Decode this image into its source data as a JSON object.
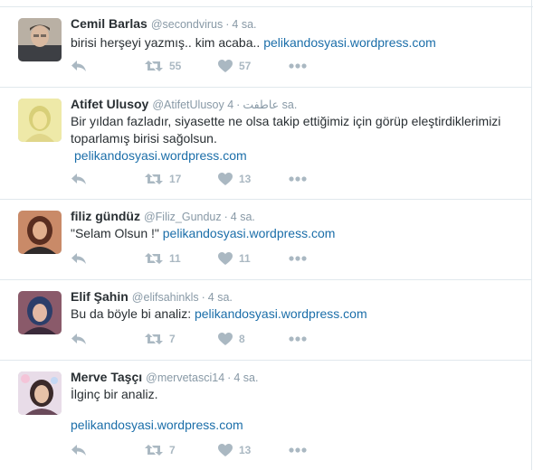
{
  "colors": {
    "link": "#1b6ea9",
    "meta": "#8899a6",
    "action": "#aab8c2",
    "separator": "#e1e8ed"
  },
  "tweets": [
    {
      "fullname": "Cemil Barlas",
      "username": "@secondvirus",
      "time": "4 sa.",
      "text": "birisi herşeyi yazmış.. kim acaba..",
      "link": "pelikandosyasi.wordpress.com",
      "retweets": "55",
      "likes": "57"
    },
    {
      "fullname": "Atifet Ulusoy",
      "username": "@AtifetUlusoy عاطفت",
      "time": "4 sa.",
      "text": "Bir yıldan fazladır, siyasette ne olsa takip ettiğimiz için görüp eleştirdiklerimizi toparlamış birisi sağolsun.",
      "link": "pelikandosyasi.wordpress.com",
      "retweets": "17",
      "likes": "13"
    },
    {
      "fullname": "filiz gündüz",
      "username": "@Filiz_Gunduz",
      "time": "4 sa.",
      "text": "\"Selam Olsun !\"",
      "link": "pelikandosyasi.wordpress.com",
      "retweets": "11",
      "likes": "11"
    },
    {
      "fullname": "Elif Şahin",
      "username": "@elifsahinkls",
      "time": "4 sa.",
      "text": "Bu da böyle bi analiz:",
      "link": "pelikandosyasi.wordpress.com",
      "retweets": "7",
      "likes": "8"
    },
    {
      "fullname": "Merve Taşçı",
      "username": "@mervetasci14",
      "time": "4 sa.",
      "text": "İlginç bir analiz.",
      "link": "pelikandosyasi.wordpress.com",
      "retweets": "7",
      "likes": "13"
    }
  ],
  "icons": [
    "reply-icon",
    "retweet-icon",
    "like-icon",
    "more-icon"
  ]
}
